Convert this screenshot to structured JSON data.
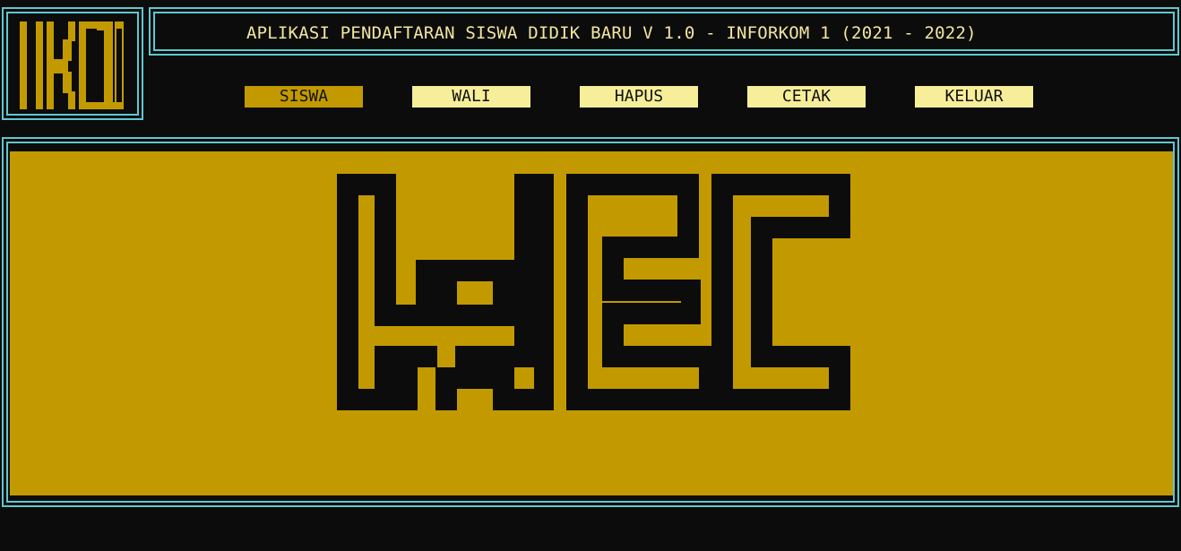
{
  "app": {
    "title": "APLIKASI PENDAFTARAN SISWA DIDIK BARU V 1.0 - INFORKOM 1 (2021 - 2022)",
    "logo_icon": "ik1-pixel-logo-icon",
    "banner_icon": "wec-pixel-banner-icon"
  },
  "menu": {
    "items": [
      {
        "label": "SISWA",
        "active": true
      },
      {
        "label": "WALI",
        "active": false
      },
      {
        "label": "HAPUS",
        "active": false
      },
      {
        "label": "CETAK",
        "active": false
      },
      {
        "label": "KELUAR",
        "active": false
      }
    ]
  },
  "colors": {
    "background": "#0c0c0c",
    "border": "#5ec8d0",
    "accent_gold": "#c29a00",
    "button_light": "#f7ee9a",
    "title_text": "#f3e6a0",
    "ink": "#101010"
  }
}
